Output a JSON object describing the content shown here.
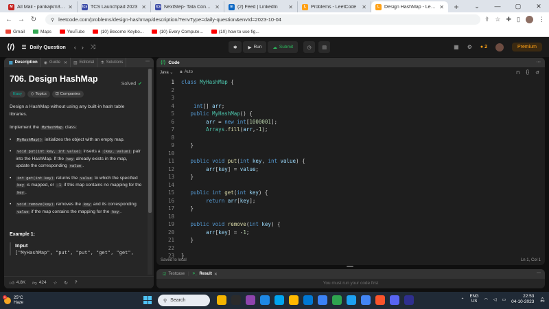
{
  "browser": {
    "tabs": [
      {
        "label": "All Mail - pankajkm347@",
        "fav_color": "#c5221f",
        "fav_text": "M",
        "active": false
      },
      {
        "label": "TCS Launchpad 2023",
        "fav_color": "#3b4ba8",
        "fav_text": "tcs",
        "active": false
      },
      {
        "label": "NextStep- Tata Consultanc",
        "fav_color": "#3b4ba8",
        "fav_text": "tcs",
        "active": false
      },
      {
        "label": "(2) Feed | LinkedIn",
        "fav_color": "#0a66c2",
        "fav_text": "in",
        "active": false
      },
      {
        "label": "Problems - LeetCode",
        "fav_color": "#ffa116",
        "fav_text": "L",
        "active": false
      },
      {
        "label": "Design HashMap - LeetCo",
        "fav_color": "#ffa116",
        "fav_text": "L",
        "active": true
      }
    ],
    "new_tab": "+",
    "window_controls": [
      "⌄",
      "—",
      "▢",
      "✕"
    ],
    "url": "leetcode.com/problems/design-hashmap/description/?envType=daily-question&envId=2023-10-04",
    "bookmarks": [
      {
        "label": "Gmail",
        "color": "#ea4335"
      },
      {
        "label": "Maps",
        "color": "#34a853"
      },
      {
        "label": "YouTube",
        "color": "#ff0000"
      },
      {
        "label": "(10) Become Keybo...",
        "color": "#ff0000"
      },
      {
        "label": "(10) Every Compute...",
        "color": "#ff0000"
      },
      {
        "label": "(10) how to use fig...",
        "color": "#ff0000"
      }
    ]
  },
  "nav": {
    "problem_list": "Daily Question",
    "run": "Run",
    "submit": "Submit",
    "streak": "2",
    "premium": "Premium"
  },
  "left": {
    "tabs": [
      {
        "label": "Description",
        "active": true
      },
      {
        "label": "Guide",
        "active": false
      },
      {
        "label": "Editorial",
        "active": false
      },
      {
        "label": "Solutions",
        "active": false
      }
    ],
    "title": "706. Design HashMap",
    "status": "Solved",
    "difficulty": "Easy",
    "chip_topics": "Topics",
    "chip_companies": "Companies",
    "intro": "Design a HashMap without using any built-in hash table libraries.",
    "implement_pre": "Implement the ",
    "implement_code": "MyHashMap",
    "implement_post": " class:",
    "b1_code": "MyHashMap()",
    "b1_text": " initializes the object with an empty map.",
    "b2_code1": "void put(int key, int value)",
    "b2_t1": " inserts a ",
    "b2_code2": "(key, value)",
    "b2_t2": " pair into the HashMap. If the ",
    "b2_code3": "key",
    "b2_t3": " already exists in the map, update the corresponding ",
    "b2_code4": "value",
    "b2_t4": ".",
    "b3_code1": "int get(int key)",
    "b3_t1": " returns the ",
    "b3_code2": "value",
    "b3_t2": " to which the specified ",
    "b3_code3": "key",
    "b3_t3": " is mapped, or ",
    "b3_code4": "-1",
    "b3_t4": " if this map contains no mapping for the ",
    "b3_code5": "key",
    "b3_t5": ".",
    "b4_code1": "void remove(key)",
    "b4_t1": " removes the ",
    "b4_code2": "key",
    "b4_t2": " and its corresponding ",
    "b4_code3": "value",
    "b4_t3": " if the map contains the mapping for the ",
    "b4_code4": "key",
    "b4_t4": ".",
    "example_title": "Example 1:",
    "example_input_label": "Input",
    "example_input": "[\"MyHashMap\", \"put\", \"put\", \"get\", \"get\",",
    "likes": "4.8K",
    "dislikes": "424"
  },
  "code": {
    "panel_title": "Code",
    "language": "Java",
    "auto": "Auto",
    "current_line": 1,
    "lines": [
      "class MyHashMap {",
      "",
      "",
      "    int[] arr;",
      "   public MyHashMap() {",
      "        arr = new int[1000001];",
      "        Arrays.fill(arr,-1);",
      "",
      "   }",
      "",
      "   public void put(int key, int value) {",
      "        arr[key] = value;",
      "   }",
      "",
      "   public int get(int key) {",
      "        return arr[key];",
      "   }",
      "",
      "   public void remove(int key) {",
      "        arr[key] = -1;",
      "   }",
      "",
      "}"
    ],
    "saved": "Saved to local",
    "cursor": "Ln 1, Col 1"
  },
  "result": {
    "tab_testcase": "Testcase",
    "tab_result": "Result",
    "message": "You must run your code first"
  },
  "taskbar": {
    "temp": "25°C",
    "weather": "Haze",
    "search": "Search",
    "lang1": "ENG",
    "lang2": "US",
    "time": "22:53",
    "date": "04-10-2023",
    "apps": [
      "#f4b400",
      "#2b2b2b",
      "#8e44ad",
      "#1e88e5",
      "#00a4ef",
      "#ffb900",
      "#0078d4",
      "#3b82f6",
      "#2ea44f",
      "#1da1f2",
      "#4285f4",
      "#fb542b",
      "#5865f2",
      "#2f2f8f"
    ]
  }
}
